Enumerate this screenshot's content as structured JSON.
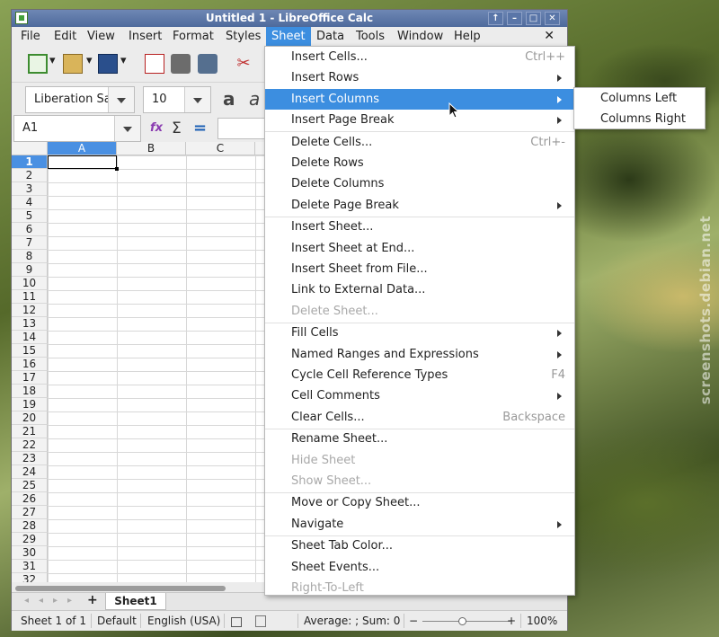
{
  "window": {
    "title": "Untitled 1 - LibreOffice Calc"
  },
  "menubar": [
    "File",
    "Edit",
    "View",
    "Insert",
    "Format",
    "Styles",
    "Sheet",
    "Data",
    "Tools",
    "Window",
    "Help"
  ],
  "menu_close": "✕",
  "font": {
    "name": "Liberation Sans",
    "size": "10"
  },
  "namebox": "A1",
  "formula_icons": {
    "function_wizard": "fx",
    "sum": "Σ",
    "equals": "="
  },
  "columns": [
    "A",
    "B",
    "C"
  ],
  "rows": [
    "1",
    "2",
    "3",
    "4",
    "5",
    "6",
    "7",
    "8",
    "9",
    "10",
    "11",
    "12",
    "13",
    "14",
    "15",
    "16",
    "17",
    "18",
    "19",
    "20",
    "21",
    "22",
    "23",
    "24",
    "25",
    "26",
    "27",
    "28",
    "29",
    "30",
    "31",
    "32"
  ],
  "sheet_tab": "Sheet1",
  "add_sheet": "+",
  "status": {
    "sheet": "Sheet 1 of 1",
    "page_style": "Default",
    "language": "English (USA)",
    "selection": "Average: ; Sum: 0",
    "zoom_minus": "−",
    "zoom_plus": "+",
    "zoom": "100%"
  },
  "sheet_menu": {
    "items": [
      {
        "label": "Insert Cells...",
        "accel": "Ctrl++"
      },
      {
        "label": "Insert Rows",
        "submenu": true
      },
      {
        "label": "Insert Columns",
        "submenu": true,
        "highlighted": true
      },
      {
        "label": "Insert Page Break",
        "submenu": true
      },
      {
        "label": "Delete Cells...",
        "accel": "Ctrl+-"
      },
      {
        "label": "Delete Rows"
      },
      {
        "label": "Delete Columns"
      },
      {
        "label": "Delete Page Break",
        "submenu": true
      },
      {
        "label": "Insert Sheet..."
      },
      {
        "label": "Insert Sheet at End..."
      },
      {
        "label": "Insert Sheet from File..."
      },
      {
        "label": "Link to External Data..."
      },
      {
        "label": "Delete Sheet...",
        "disabled": true
      },
      {
        "label": "Fill Cells",
        "submenu": true
      },
      {
        "label": "Named Ranges and Expressions",
        "submenu": true
      },
      {
        "label": "Cycle Cell Reference Types",
        "accel": "F4"
      },
      {
        "label": "Cell Comments",
        "submenu": true
      },
      {
        "label": "Clear Cells...",
        "accel": "Backspace"
      },
      {
        "label": "Rename Sheet..."
      },
      {
        "label": "Hide Sheet",
        "disabled": true
      },
      {
        "label": "Show Sheet...",
        "disabled": true
      },
      {
        "label": "Move or Copy Sheet..."
      },
      {
        "label": "Navigate",
        "submenu": true
      },
      {
        "label": "Sheet Tab Color..."
      },
      {
        "label": "Sheet Events..."
      },
      {
        "label": "Right-To-Left",
        "disabled": true
      }
    ]
  },
  "insert_columns_submenu": [
    "Columns Left",
    "Columns Right"
  ],
  "watermark": "screenshots.debian.net",
  "colors": {
    "highlight": "#3c8ee0",
    "titlebar": "#5a76a8",
    "selected_header": "#4a90e2"
  }
}
